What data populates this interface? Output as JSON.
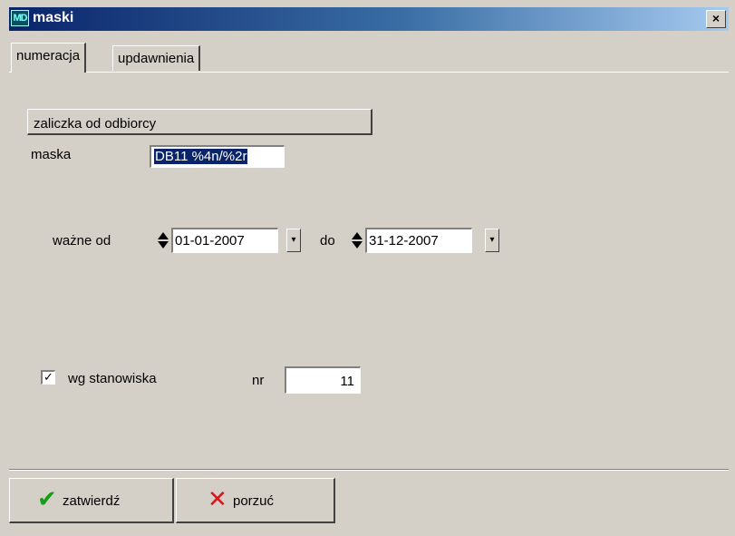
{
  "window": {
    "title": "maski",
    "icon": "MD",
    "close_label": "×"
  },
  "tabs": [
    {
      "label": "numeracja",
      "active": true
    },
    {
      "label": "updawnienia",
      "active": false
    }
  ],
  "document_type": "zaliczka od odbiorcy",
  "mask": {
    "label": "maska",
    "value": "DB11 %4n/%2r"
  },
  "validity": {
    "from_label": "ważne od",
    "from_value": "01-01-2007",
    "to_label": "do",
    "to_value": "31-12-2007"
  },
  "workstation": {
    "checkbox_label": "wg stanowiska",
    "checked": true,
    "nr_label": "nr",
    "nr_value": "11"
  },
  "buttons": {
    "confirm_label": "zatwierdź",
    "confirm_icon": "check-icon",
    "cancel_label": "porzuć",
    "cancel_icon": "x-icon"
  },
  "colors": {
    "title_bar": "#0a246a",
    "face": "#d4d0c8",
    "confirm_icon": "#13a013",
    "cancel_icon": "#e0101a"
  }
}
